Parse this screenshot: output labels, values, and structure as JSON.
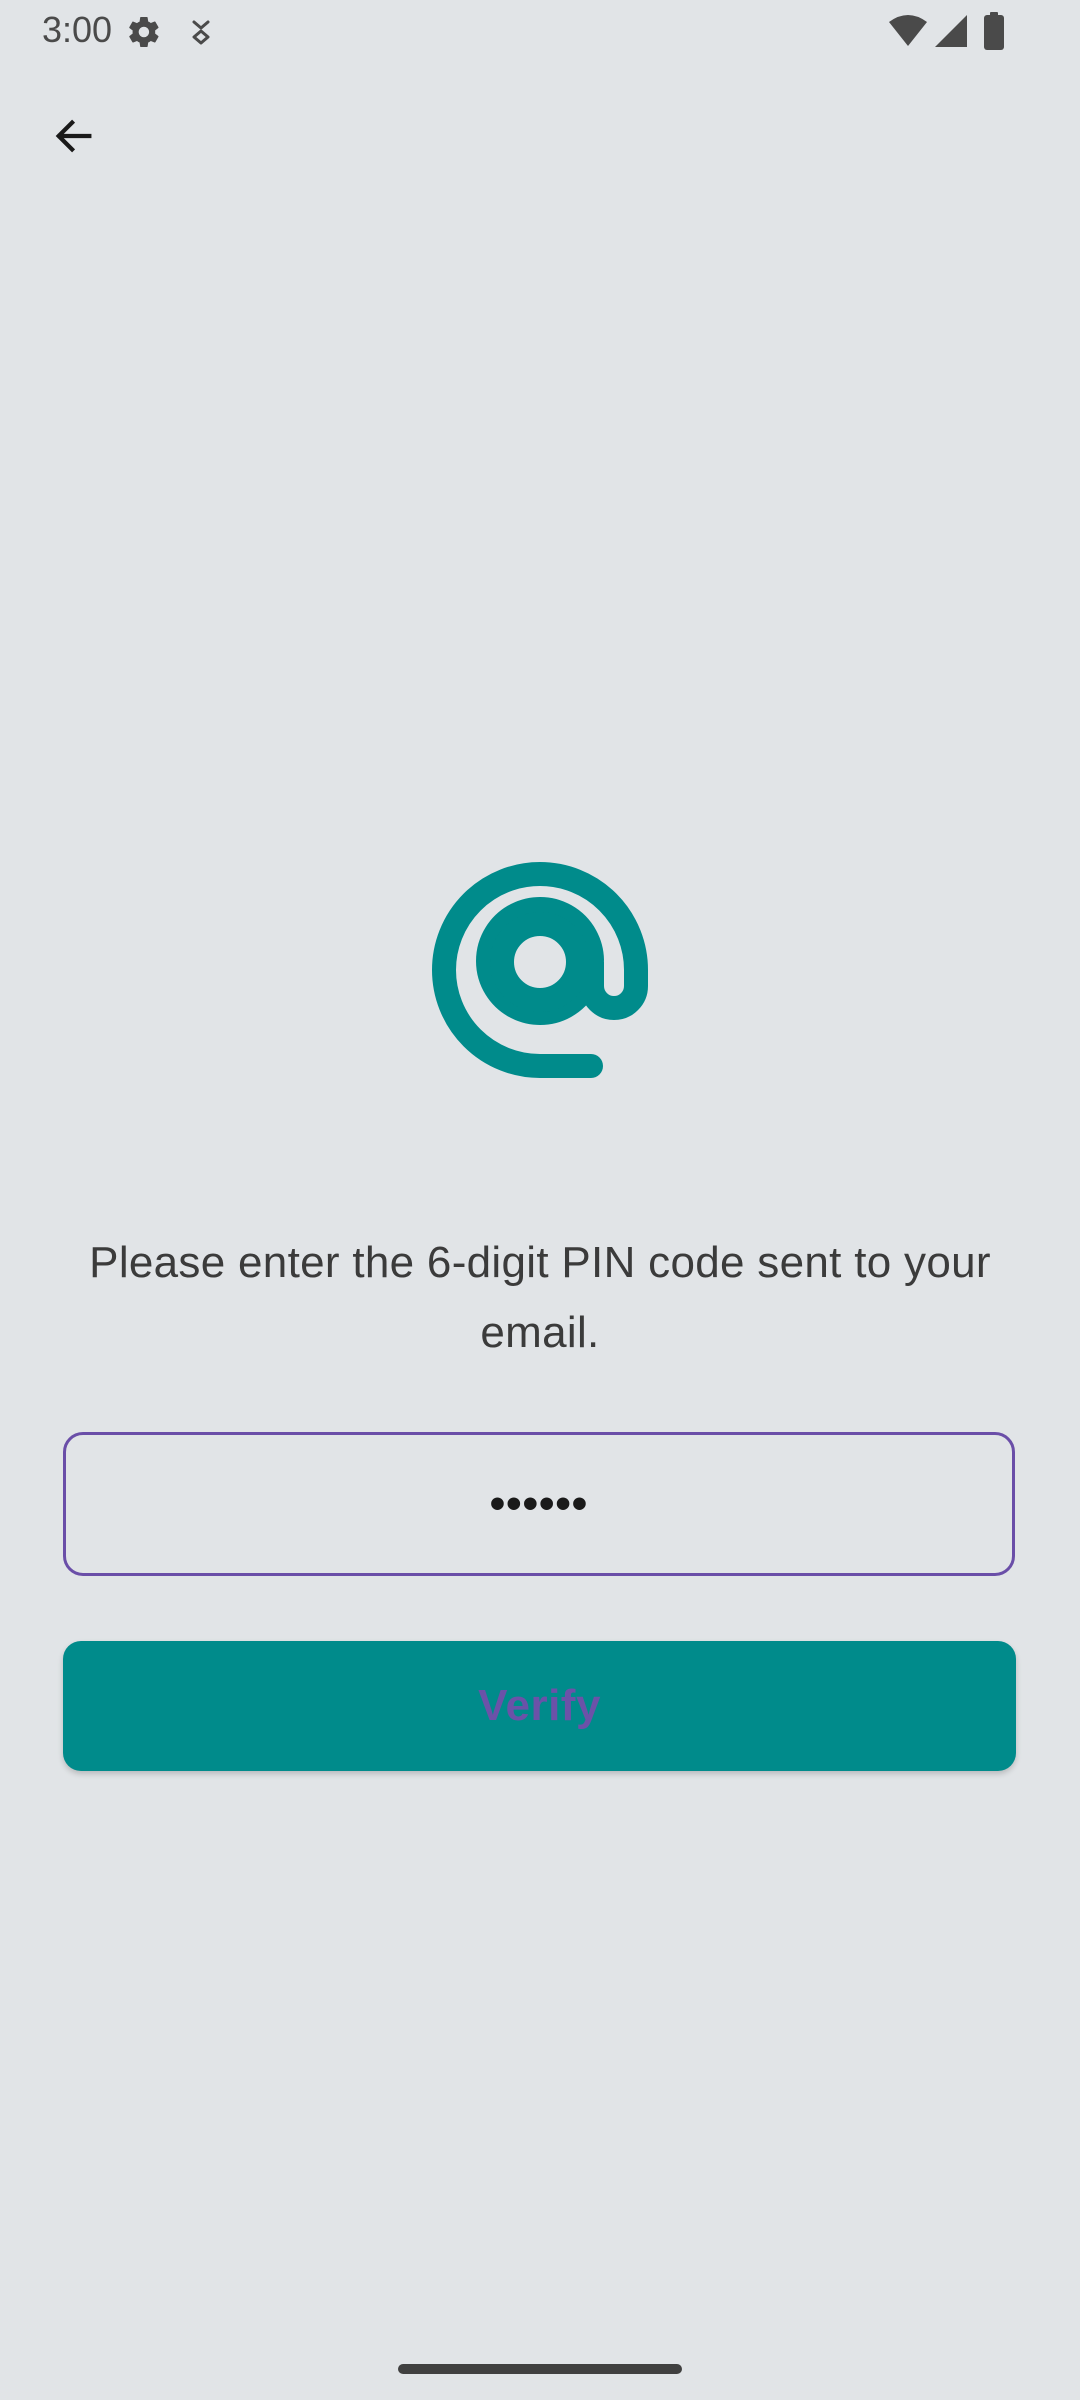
{
  "status_bar": {
    "time": "3:00",
    "icons": [
      "settings-gear-icon",
      "download-arrow-icon",
      "wifi-icon",
      "cellular-signal-icon",
      "battery-icon"
    ]
  },
  "navigation": {
    "back_icon": "arrow-left-icon"
  },
  "logo": {
    "icon": "at-sign-icon",
    "color": "#008b8b"
  },
  "content": {
    "instructions": "Please enter the 6-digit PIN code sent to your email."
  },
  "pin_input": {
    "value": "••••••",
    "border_color": "#6a4ea8"
  },
  "verify_button": {
    "label": "Verify",
    "background": "#008b8b",
    "label_color": "#6b52a8"
  },
  "colors": {
    "background": "#e1e4e7",
    "accent": "#008b8b"
  }
}
